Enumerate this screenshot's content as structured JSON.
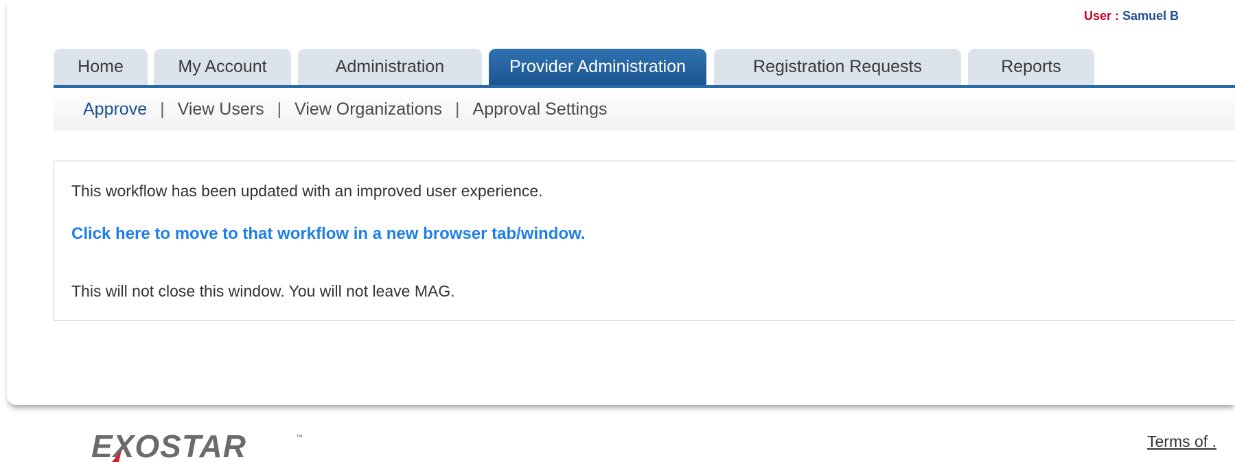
{
  "user": {
    "label": "User :",
    "name": "Samuel B"
  },
  "tabs": [
    {
      "label": "Home",
      "active": false
    },
    {
      "label": "My Account",
      "active": false
    },
    {
      "label": "Administration",
      "active": false
    },
    {
      "label": "Provider Administration",
      "active": true
    },
    {
      "label": "Registration Requests",
      "active": false
    },
    {
      "label": "Reports",
      "active": false
    }
  ],
  "subnav": {
    "items": [
      {
        "label": "Approve",
        "active": true
      },
      {
        "label": "View Users",
        "active": false
      },
      {
        "label": "View Organizations",
        "active": false
      },
      {
        "label": "Approval Settings",
        "active": false
      }
    ],
    "separator": "|"
  },
  "notice": {
    "line1": "This workflow has been updated with an improved user experience.",
    "link": "Click here to move to that workflow in a new browser tab/window.",
    "line3": "This will not close this window. You will not leave MAG."
  },
  "footer": {
    "logo_text": "EXOSTAR",
    "logo_tm": "™",
    "terms": "Terms of ."
  },
  "colors": {
    "accent": "#1d4f91",
    "active_tab": "#2a6aa8",
    "link": "#1e7fe8",
    "user_label": "#cc0022"
  }
}
